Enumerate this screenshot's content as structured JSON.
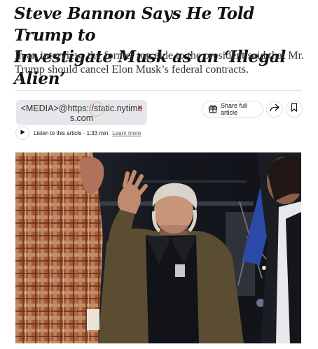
{
  "article": {
    "headline_line1": "Steve Bannon Says He Told Trump to",
    "headline_line2": "Investigate Musk as an ‘Illegal Alien’",
    "dek": "In an interview, the former top aide to the president said that Mr. Trump should cancel Elon Musk’s federal contracts."
  },
  "media_placeholder": {
    "line1": "<MEDIA>@https://static.nytime",
    "line2": "s.com",
    "close_glyph": "×"
  },
  "toolbar": {
    "share_label": "Share full article",
    "share_icon": "gift-icon",
    "forward_icon": "forward-arrow-icon",
    "save_icon": "bookmark-icon"
  },
  "audio": {
    "listen_label": "Listen to this article · 1:33 min",
    "learn_more": "Learn more"
  },
  "colors": {
    "text": "#121212",
    "dek": "#363636",
    "divider": "#e2e2e2",
    "media_bg": "#e6e7ea",
    "close_mark": "#d43a3a"
  }
}
